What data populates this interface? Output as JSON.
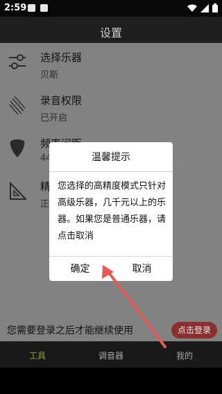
{
  "status_bar": {
    "time": "2:59",
    "icons": [
      "notification-icon",
      "image-icon",
      "wifi-icon",
      "signal-icon",
      "battery-icon"
    ]
  },
  "header": {
    "title": "设置"
  },
  "settings": {
    "items": [
      {
        "title": "选择乐器",
        "subtitle": "贝斯",
        "icon": "sliders-icon"
      },
      {
        "title": "录音权限",
        "subtitle": "已开启",
        "icon": "microphone-icon"
      },
      {
        "title": "频率间距",
        "subtitle": "44",
        "icon": "guitar-pick-icon"
      },
      {
        "title": "精",
        "subtitle": "正",
        "icon": "ruler-triangle-icon"
      }
    ]
  },
  "login_bar": {
    "message": "您需要登录之后才能继续使用",
    "button_label": "点击登录"
  },
  "bottom_nav": {
    "items": [
      "工具",
      "调音器",
      "我的"
    ],
    "active": "工具",
    "active_color": "#8ea53a"
  },
  "dialog": {
    "title": "温馨提示",
    "message": "您选择的高精度模式只针对高级乐器，几千元以上的乐器。如果您是普通乐器，请点击取消",
    "confirm_label": "确定",
    "cancel_label": "取消"
  },
  "annotation": {
    "arrow_color": "#e05a5a"
  }
}
